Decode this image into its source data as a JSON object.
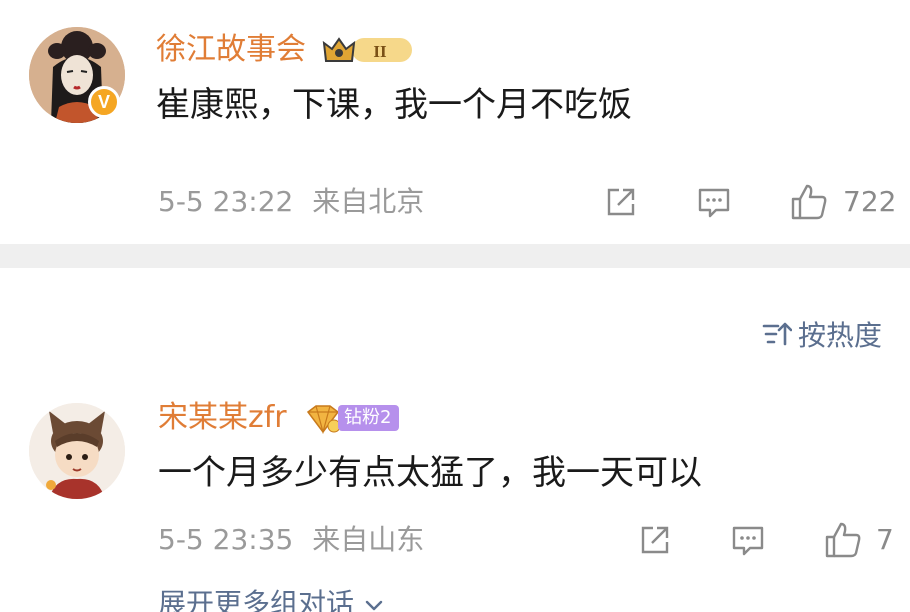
{
  "comments": [
    {
      "username": "徐江故事会",
      "text": "崔康熙，下课，我一个月不吃饭",
      "timestamp": "5-5 23:22",
      "location": "来自北京",
      "like_count": "722",
      "verified_badge": "V",
      "medal_label": "II"
    },
    {
      "username": "宋某某zfr",
      "text": "一个月多少有点太猛了，我一天可以",
      "timestamp": "5-5 23:35",
      "location": "来自山东",
      "like_count": "7",
      "fan_badge": "钻粉2"
    }
  ],
  "sort": {
    "label": "按热度"
  },
  "expand_replies": "展开更多组对话",
  "colors": {
    "username": "#e07d36",
    "link": "#5b6f8f",
    "meta": "#9a9a9a",
    "separator": "#efefef",
    "fan_badge": "#b690ec",
    "verified": "#f5a623"
  },
  "icons": [
    "share-icon",
    "comment-icon",
    "like-icon",
    "sort-icon",
    "chevron-down-icon"
  ]
}
